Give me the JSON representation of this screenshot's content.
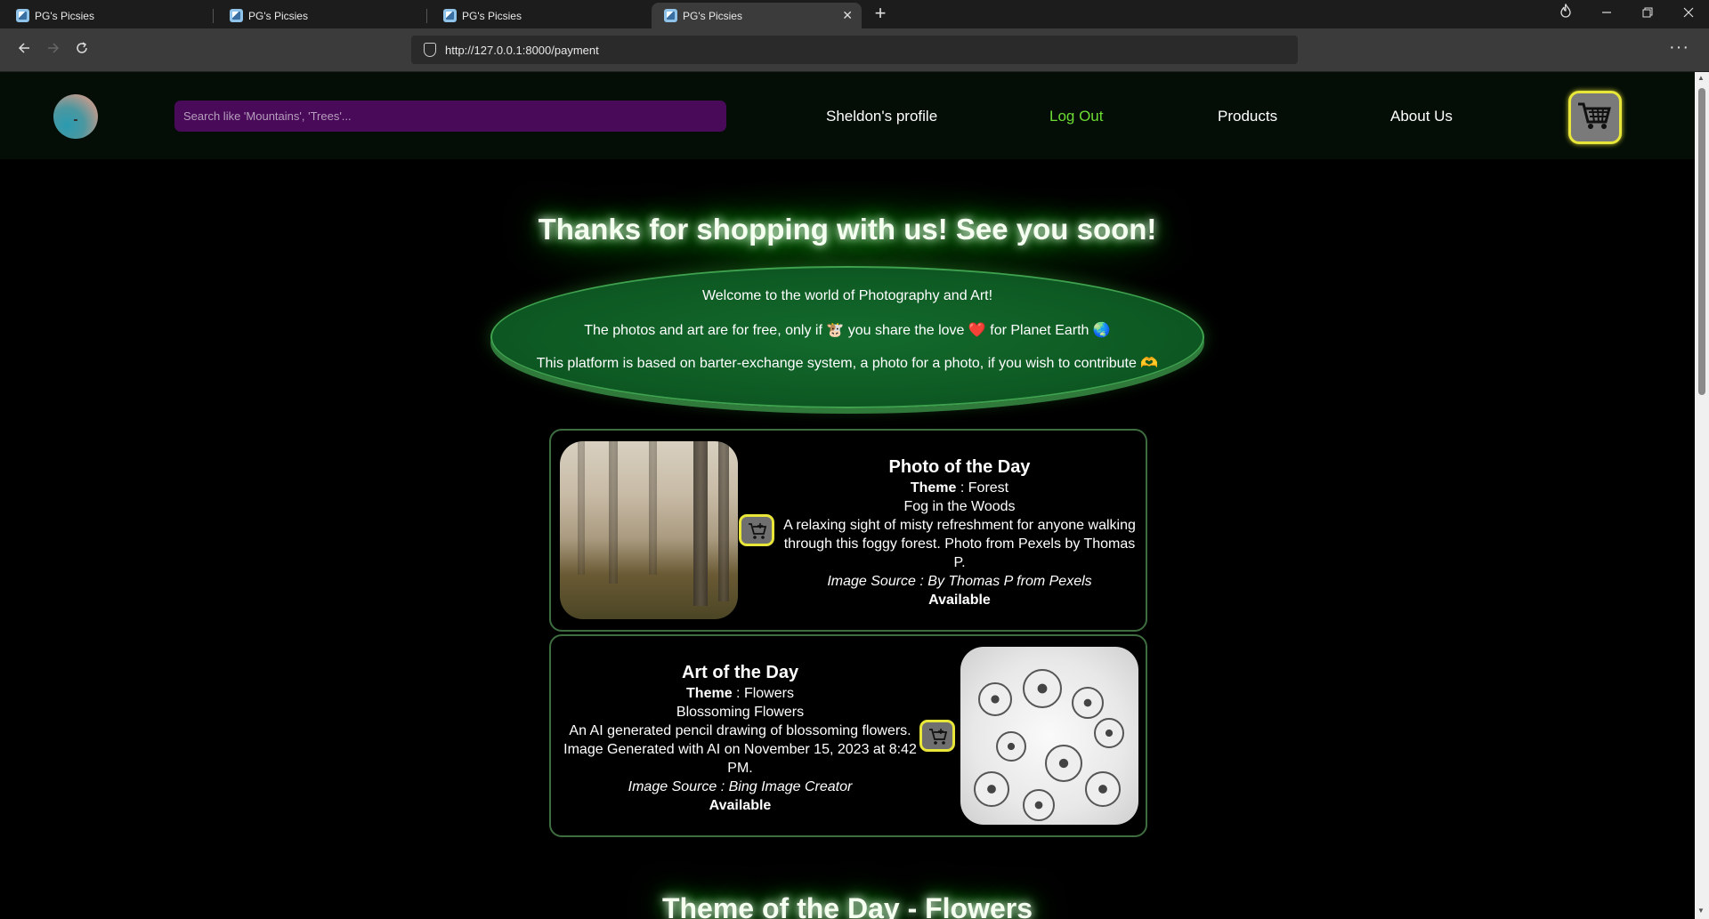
{
  "browser": {
    "tabs": [
      {
        "title": "PG's Picsies"
      },
      {
        "title": "PG's Picsies"
      },
      {
        "title": "PG's Picsies"
      },
      {
        "title": "PG's Picsies"
      }
    ],
    "new_tab": "+",
    "close_tab": "✕",
    "url": "http://127.0.0.1:8000/payment",
    "menu": "···"
  },
  "header": {
    "search_placeholder": "Search like 'Mountains', 'Trees'...",
    "nav": {
      "profile": "Sheldon's profile",
      "logout": "Log Out",
      "products": "Products",
      "about": "About Us"
    },
    "colors": {
      "logout": "#6ddc34",
      "search_bg": "#4a0a5a",
      "cart_border": "#e9e63a"
    }
  },
  "main": {
    "thanks": "Thanks for shopping with us! See you soon!",
    "welcome_lines": [
      "Welcome to the world of Photography and Art!",
      "The photos and art are for free, only if 🐮 you share the love ❤️ for Planet Earth 🌏",
      "This platform is based on barter-exchange system, a photo for a photo, if you wish to contribute 🫶"
    ],
    "photo_of_day": {
      "title": "Photo of the Day",
      "theme_label": "Theme",
      "theme": " : Forest",
      "name": "Fog in the Woods",
      "description": "A relaxing sight of misty refreshment for anyone walking through this foggy forest. Photo from Pexels by Thomas P.",
      "source": "Image Source : By Thomas P from Pexels",
      "status": "Available"
    },
    "art_of_day": {
      "title": "Art of the Day",
      "theme_label": "Theme",
      "theme": " : Flowers",
      "name": "Blossoming Flowers",
      "description": "An AI generated pencil drawing of blossoming flowers. Image Generated with AI on November 15, 2023 at 8:42 PM.",
      "source": "Image Source : Bing Image Creator",
      "status": "Available"
    },
    "theme_of_day": "Theme of the Day - Flowers"
  }
}
